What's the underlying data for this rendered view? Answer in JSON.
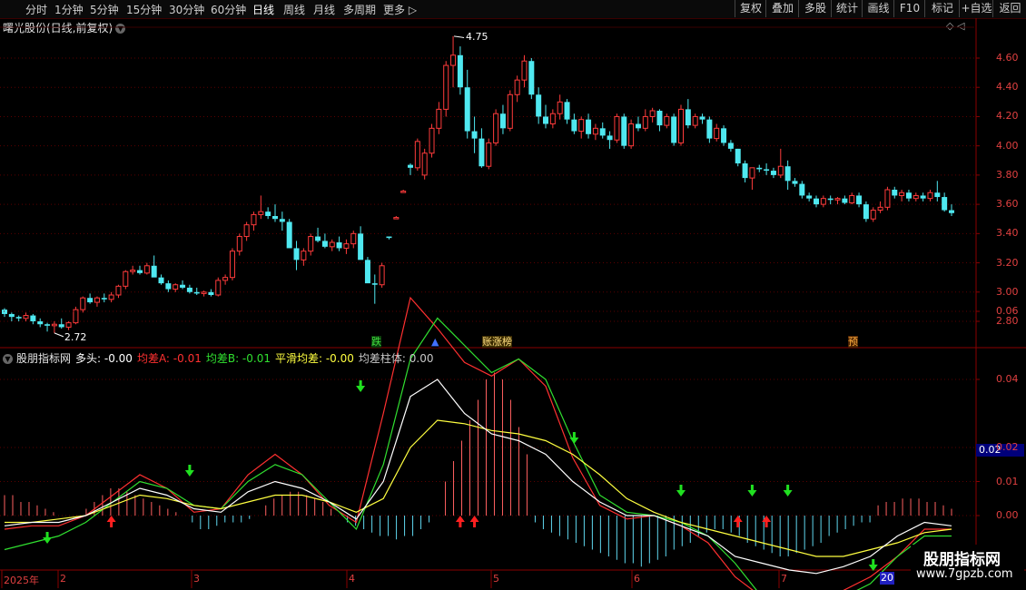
{
  "toolbar": {
    "periods": [
      "分时",
      "1分钟",
      "5分钟",
      "15分钟",
      "30分钟",
      "60分钟",
      "日线",
      "周线",
      "月线",
      "多周期",
      "更多 ▷"
    ],
    "active_period": "日线",
    "tools": [
      "复权",
      "叠加",
      "多股",
      "统计",
      "画线",
      "F10",
      "标记",
      "+自选",
      "返回"
    ]
  },
  "stock": {
    "title": "曙光股份(日线,前复权)"
  },
  "top_icons": "◇ ◁",
  "price_axis": [
    "4.60",
    "4.40",
    "4.20",
    "4.00",
    "3.80",
    "3.60",
    "3.40",
    "3.20",
    "3.00",
    "2.80"
  ],
  "osc_axis": [
    "0.06",
    "0.04",
    "0.02",
    "0.01",
    "0.00"
  ],
  "high_label": "4.75",
  "low_label": "2.72",
  "markers": [
    {
      "text": "跌",
      "color": "#40e040",
      "bg": "#0a3a0a"
    },
    {
      "text": "▲",
      "color": "#4070ff",
      "bg": "#000000"
    },
    {
      "text": "账涨榜",
      "color": "#ffe080",
      "bg": "#3a2a00"
    },
    {
      "text": "预",
      "color": "#ffb040",
      "bg": "#4a2000"
    }
  ],
  "indicator": {
    "name": "股朋指标网",
    "duotou": "多头: -0.00",
    "junchaA": "均差A: -0.01",
    "junchaB": "均差B: -0.01",
    "pinghua": "平滑均差: -0.00",
    "zhuti": "均差柱体: 0.00"
  },
  "dates": [
    "2025年",
    "2",
    "3",
    "4",
    "5",
    "6",
    "7"
  ],
  "cursor_value": "0.02",
  "cursor_date": "20",
  "watermark": {
    "line1": "股朋指标网",
    "line2": "www.7gpzb.com"
  },
  "colors": {
    "up": "#ff3b3b",
    "down": "#4fe8f0",
    "grid": "#5a0000",
    "lineA": "#ff3030",
    "lineB": "#30e030",
    "smooth": "#ffff40",
    "duotou": "#ffffff",
    "arrowUp": "#ff2020",
    "arrowDown": "#20e020"
  },
  "chart_data": [
    {
      "type": "candlestick",
      "title": "曙光股份(日线,前复权)",
      "ylim": [
        2.7,
        4.75
      ],
      "ohlc": [
        [
          2.88,
          2.89,
          2.83,
          2.85
        ],
        [
          2.85,
          2.86,
          2.8,
          2.83
        ],
        [
          2.83,
          2.84,
          2.8,
          2.82
        ],
        [
          2.82,
          2.86,
          2.8,
          2.84
        ],
        [
          2.84,
          2.85,
          2.78,
          2.8
        ],
        [
          2.8,
          2.82,
          2.76,
          2.78
        ],
        [
          2.78,
          2.79,
          2.73,
          2.77
        ],
        [
          2.77,
          2.8,
          2.72,
          2.78
        ],
        [
          2.78,
          2.82,
          2.75,
          2.76
        ],
        [
          2.76,
          2.8,
          2.74,
          2.79
        ],
        [
          2.79,
          2.9,
          2.78,
          2.88
        ],
        [
          2.88,
          2.97,
          2.86,
          2.96
        ],
        [
          2.96,
          2.99,
          2.92,
          2.93
        ],
        [
          2.93,
          2.97,
          2.9,
          2.96
        ],
        [
          2.96,
          2.99,
          2.93,
          2.95
        ],
        [
          2.95,
          3.0,
          2.93,
          2.98
        ],
        [
          2.98,
          3.05,
          2.96,
          3.04
        ],
        [
          3.04,
          3.15,
          3.02,
          3.14
        ],
        [
          3.14,
          3.18,
          3.12,
          3.15
        ],
        [
          3.15,
          3.18,
          3.12,
          3.13
        ],
        [
          3.13,
          3.2,
          3.12,
          3.18
        ],
        [
          3.18,
          3.25,
          3.16,
          3.1
        ],
        [
          3.1,
          3.12,
          3.05,
          3.06
        ],
        [
          3.06,
          3.08,
          3.0,
          3.02
        ],
        [
          3.02,
          3.06,
          3.0,
          3.05
        ],
        [
          3.05,
          3.08,
          3.02,
          3.03
        ],
        [
          3.03,
          3.05,
          2.99,
          3.0
        ],
        [
          3.0,
          3.03,
          2.98,
          2.99
        ],
        [
          2.99,
          3.01,
          2.97,
          3.0
        ],
        [
          3.0,
          3.02,
          2.97,
          2.98
        ],
        [
          2.98,
          3.1,
          2.97,
          3.08
        ],
        [
          3.08,
          3.12,
          3.05,
          3.1
        ],
        [
          3.1,
          3.3,
          3.08,
          3.28
        ],
        [
          3.28,
          3.4,
          3.25,
          3.38
        ],
        [
          3.38,
          3.48,
          3.35,
          3.46
        ],
        [
          3.46,
          3.55,
          3.42,
          3.53
        ],
        [
          3.53,
          3.66,
          3.5,
          3.55
        ],
        [
          3.55,
          3.58,
          3.5,
          3.52
        ],
        [
          3.52,
          3.6,
          3.48,
          3.5
        ],
        [
          3.5,
          3.55,
          3.42,
          3.48
        ],
        [
          3.48,
          3.5,
          3.35,
          3.3
        ],
        [
          3.3,
          3.35,
          3.15,
          3.22
        ],
        [
          3.22,
          3.3,
          3.18,
          3.28
        ],
        [
          3.28,
          3.4,
          3.25,
          3.38
        ],
        [
          3.38,
          3.44,
          3.34,
          3.35
        ],
        [
          3.35,
          3.4,
          3.3,
          3.31
        ],
        [
          3.31,
          3.36,
          3.28,
          3.34
        ],
        [
          3.34,
          3.38,
          3.28,
          3.3
        ],
        [
          3.3,
          3.36,
          3.26,
          3.33
        ],
        [
          3.33,
          3.42,
          3.3,
          3.4
        ],
        [
          3.4,
          3.45,
          3.25,
          3.22
        ],
        [
          3.22,
          3.24,
          3.08,
          3.06
        ],
        [
          3.06,
          3.12,
          2.92,
          3.05
        ],
        [
          3.05,
          3.2,
          3.03,
          3.18
        ],
        [
          3.38,
          3.38,
          3.36,
          3.37
        ],
        [
          3.51,
          3.52,
          3.5,
          3.51
        ],
        [
          3.69,
          3.7,
          3.68,
          3.69
        ],
        [
          3.87,
          3.88,
          3.8,
          3.85
        ],
        [
          3.85,
          4.05,
          3.83,
          4.03
        ],
        [
          3.8,
          3.98,
          3.77,
          3.95
        ],
        [
          3.95,
          4.15,
          3.92,
          4.12
        ],
        [
          4.12,
          4.3,
          4.08,
          4.25
        ],
        [
          4.25,
          4.58,
          4.2,
          4.55
        ],
        [
          4.55,
          4.75,
          4.4,
          4.62
        ],
        [
          4.62,
          4.68,
          4.35,
          4.4
        ],
        [
          4.4,
          4.52,
          4.05,
          4.1
        ],
        [
          4.1,
          4.2,
          3.95,
          4.05
        ],
        [
          4.05,
          4.12,
          3.85,
          3.86
        ],
        [
          3.86,
          4.05,
          3.84,
          4.02
        ],
        [
          4.02,
          4.25,
          4.0,
          4.22
        ],
        [
          4.22,
          4.28,
          4.08,
          4.12
        ],
        [
          4.12,
          4.38,
          4.1,
          4.35
        ],
        [
          4.35,
          4.48,
          4.3,
          4.45
        ],
        [
          4.45,
          4.62,
          4.4,
          4.58
        ],
        [
          4.58,
          4.6,
          4.32,
          4.35
        ],
        [
          4.35,
          4.4,
          4.15,
          4.2
        ],
        [
          4.2,
          4.28,
          4.12,
          4.15
        ],
        [
          4.15,
          4.25,
          4.12,
          4.22
        ],
        [
          4.22,
          4.35,
          4.18,
          4.3
        ],
        [
          4.3,
          4.32,
          4.15,
          4.18
        ],
        [
          4.18,
          4.22,
          4.08,
          4.1
        ],
        [
          4.1,
          4.2,
          4.05,
          4.18
        ],
        [
          4.18,
          4.22,
          4.05,
          4.08
        ],
        [
          4.08,
          4.15,
          4.04,
          4.12
        ],
        [
          4.12,
          4.16,
          4.05,
          4.07
        ],
        [
          4.07,
          4.1,
          3.98,
          4.04
        ],
        [
          4.04,
          4.22,
          4.02,
          4.2
        ],
        [
          4.2,
          4.22,
          3.98,
          4.0
        ],
        [
          4.0,
          4.18,
          3.98,
          4.15
        ],
        [
          4.15,
          4.2,
          4.1,
          4.12
        ],
        [
          4.12,
          4.25,
          4.1,
          4.2
        ],
        [
          4.2,
          4.26,
          4.16,
          4.24
        ],
        [
          4.24,
          4.25,
          4.1,
          4.14
        ],
        [
          4.14,
          4.22,
          4.12,
          4.2
        ],
        [
          4.2,
          4.22,
          4.0,
          4.02
        ],
        [
          4.02,
          4.28,
          4.0,
          4.25
        ],
        [
          4.25,
          4.32,
          4.12,
          4.14
        ],
        [
          4.14,
          4.22,
          4.12,
          4.2
        ],
        [
          4.2,
          4.22,
          4.15,
          4.18
        ],
        [
          4.18,
          4.2,
          4.02,
          4.05
        ],
        [
          4.05,
          4.15,
          4.03,
          4.12
        ],
        [
          4.12,
          4.14,
          4.0,
          4.02
        ],
        [
          4.02,
          4.04,
          3.96,
          3.98
        ],
        [
          3.98,
          3.98,
          3.86,
          3.88
        ],
        [
          3.88,
          3.9,
          3.75,
          3.78
        ],
        [
          3.78,
          3.8,
          3.7,
          3.85
        ],
        [
          3.85,
          3.87,
          3.82,
          3.84
        ],
        [
          3.84,
          3.88,
          3.8,
          3.83
        ],
        [
          3.83,
          3.85,
          3.78,
          3.8
        ],
        [
          3.8,
          3.98,
          3.78,
          3.86
        ],
        [
          3.86,
          3.9,
          3.7,
          3.76
        ],
        [
          3.76,
          3.78,
          3.72,
          3.74
        ],
        [
          3.74,
          3.76,
          3.64,
          3.66
        ],
        [
          3.66,
          3.68,
          3.62,
          3.64
        ],
        [
          3.64,
          3.66,
          3.58,
          3.6
        ],
        [
          3.6,
          3.66,
          3.58,
          3.64
        ],
        [
          3.64,
          3.66,
          3.6,
          3.63
        ],
        [
          3.63,
          3.65,
          3.6,
          3.64
        ],
        [
          3.64,
          3.66,
          3.6,
          3.61
        ],
        [
          3.61,
          3.68,
          3.6,
          3.66
        ],
        [
          3.66,
          3.68,
          3.58,
          3.6
        ],
        [
          3.6,
          3.62,
          3.48,
          3.5
        ],
        [
          3.5,
          3.58,
          3.48,
          3.56
        ],
        [
          3.56,
          3.62,
          3.54,
          3.58
        ],
        [
          3.58,
          3.72,
          3.56,
          3.7
        ],
        [
          3.7,
          3.72,
          3.64,
          3.66
        ],
        [
          3.66,
          3.7,
          3.62,
          3.68
        ],
        [
          3.68,
          3.7,
          3.62,
          3.64
        ],
        [
          3.64,
          3.68,
          3.62,
          3.66
        ],
        [
          3.66,
          3.68,
          3.62,
          3.64
        ],
        [
          3.64,
          3.7,
          3.62,
          3.68
        ],
        [
          3.68,
          3.76,
          3.62,
          3.65
        ],
        [
          3.65,
          3.68,
          3.55,
          3.56
        ],
        [
          3.56,
          3.6,
          3.52,
          3.54
        ]
      ]
    },
    {
      "type": "line",
      "title": "股朋指标网",
      "ylim": [
        -0.02,
        0.07
      ],
      "series": [
        {
          "name": "均差A",
          "values": [
            -0.004,
            -0.003,
            -0.003,
            0.0,
            0.006,
            0.012,
            0.008,
            0.001,
            0.002,
            0.012,
            0.018,
            0.012,
            0.003,
            -0.002,
            0.03,
            0.064,
            0.055,
            0.045,
            0.041,
            0.046,
            0.038,
            0.017,
            0.003,
            -0.001,
            0.0,
            -0.003,
            -0.008,
            -0.018,
            -0.024,
            -0.026,
            -0.027,
            -0.022,
            -0.018,
            -0.012,
            -0.004,
            -0.004
          ]
        },
        {
          "name": "均差B",
          "values": [
            -0.01,
            -0.008,
            -0.006,
            -0.002,
            0.004,
            0.01,
            0.008,
            0.003,
            0.002,
            0.01,
            0.015,
            0.012,
            0.004,
            -0.004,
            0.015,
            0.046,
            0.058,
            0.05,
            0.042,
            0.046,
            0.04,
            0.022,
            0.006,
            0.001,
            0.0,
            -0.002,
            -0.006,
            -0.014,
            -0.024,
            -0.027,
            -0.028,
            -0.024,
            -0.02,
            -0.012,
            -0.006,
            -0.006
          ]
        },
        {
          "name": "平滑均差",
          "values": [
            -0.002,
            -0.002,
            -0.001,
            0.0,
            0.003,
            0.006,
            0.005,
            0.003,
            0.002,
            0.004,
            0.006,
            0.006,
            0.004,
            0.001,
            0.005,
            0.02,
            0.028,
            0.027,
            0.025,
            0.024,
            0.022,
            0.018,
            0.012,
            0.005,
            0.001,
            -0.002,
            -0.004,
            -0.006,
            -0.008,
            -0.01,
            -0.012,
            -0.012,
            -0.01,
            -0.008,
            -0.005,
            -0.004
          ]
        },
        {
          "name": "多头",
          "values": [
            -0.003,
            -0.002,
            -0.002,
            0.0,
            0.004,
            0.008,
            0.006,
            0.002,
            0.001,
            0.007,
            0.01,
            0.008,
            0.004,
            -0.001,
            0.01,
            0.035,
            0.04,
            0.03,
            0.024,
            0.022,
            0.018,
            0.01,
            0.004,
            0.0,
            0.0,
            -0.003,
            -0.006,
            -0.012,
            -0.014,
            -0.016,
            -0.017,
            -0.015,
            -0.012,
            -0.006,
            -0.002,
            -0.003
          ]
        }
      ],
      "histogram": [
        0.006,
        0.006,
        0.004,
        0.004,
        0.003,
        0.002,
        0.001,
        0.0,
        0.0,
        0.0,
        0.002,
        0.004,
        0.006,
        0.008,
        0.008,
        0.007,
        0.006,
        0.005,
        0.004,
        0.003,
        0.002,
        0.001,
        0.0,
        -0.002,
        -0.004,
        -0.004,
        -0.003,
        -0.002,
        -0.002,
        -0.002,
        -0.001,
        0.0,
        0.003,
        0.005,
        0.006,
        0.007,
        0.007,
        0.006,
        0.005,
        0.004,
        0.002,
        0.0,
        -0.002,
        -0.003,
        -0.004,
        -0.005,
        -0.006,
        -0.006,
        -0.007,
        -0.006,
        -0.006,
        -0.004,
        -0.002,
        0.0,
        0.01,
        0.016,
        0.022,
        0.028,
        0.034,
        0.04,
        0.042,
        0.04,
        0.034,
        0.026,
        0.018,
        -0.002,
        -0.004,
        -0.005,
        -0.006,
        -0.007,
        -0.008,
        -0.009,
        -0.01,
        -0.011,
        -0.012,
        -0.013,
        -0.014,
        -0.014,
        -0.015,
        -0.014,
        -0.013,
        -0.012,
        -0.01,
        -0.009,
        -0.008,
        -0.006,
        -0.005,
        -0.004,
        -0.004,
        -0.005,
        -0.006,
        -0.008,
        -0.009,
        -0.01,
        -0.011,
        -0.012,
        -0.012,
        -0.011,
        -0.01,
        -0.009,
        -0.008,
        -0.006,
        -0.005,
        -0.004,
        -0.003,
        -0.002,
        -0.002,
        0.003,
        0.004,
        0.004,
        0.005,
        0.005,
        0.005,
        0.004,
        0.004,
        0.003,
        0.002
      ],
      "signals": [
        {
          "i": 6,
          "dir": "down"
        },
        {
          "i": 15,
          "dir": "up"
        },
        {
          "i": 26,
          "dir": "down"
        },
        {
          "i": 50,
          "dir": "down"
        },
        {
          "i": 64,
          "dir": "up"
        },
        {
          "i": 66,
          "dir": "up"
        },
        {
          "i": 80,
          "dir": "down"
        },
        {
          "i": 95,
          "dir": "down"
        },
        {
          "i": 103,
          "dir": "up"
        },
        {
          "i": 105,
          "dir": "down"
        },
        {
          "i": 107,
          "dir": "up"
        },
        {
          "i": 110,
          "dir": "down"
        },
        {
          "i": 122,
          "dir": "down"
        },
        {
          "i": 132,
          "dir": "down"
        },
        {
          "i": 139,
          "dir": "down"
        }
      ]
    }
  ]
}
